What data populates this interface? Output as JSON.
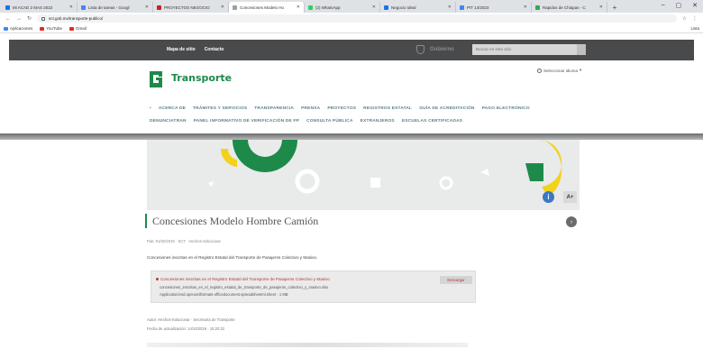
{
  "browser": {
    "tabs": [
      {
        "label": "Mi ACAD 2 MAS 2022",
        "color": "#1a73e8",
        "active": false
      },
      {
        "label": "Lista de tareas - Googl",
        "color": "#4285f4",
        "active": false
      },
      {
        "label": "PROYECTOS NEGOCIO",
        "color": "#c5221f",
        "active": false
      },
      {
        "label": "Concesiones Modelo Ho",
        "color": "#9aa0a6",
        "active": true
      },
      {
        "label": "(2) WhatsApp",
        "color": "#25d366",
        "active": false
      },
      {
        "label": "Negocio Ideal",
        "color": "#1a73e8",
        "active": false
      },
      {
        "label": "PIT 14/2023",
        "color": "#4285f4",
        "active": false
      },
      {
        "label": "Rapidos de Chiapas - C",
        "color": "#34a853",
        "active": false
      }
    ],
    "url": "sct.gob.mx/transporte-publico/",
    "bookmarks": [
      {
        "label": "Aplicaciones",
        "color": "#4285f4"
      },
      {
        "label": "YouTube",
        "color": "#d93025"
      },
      {
        "label": "Gmail",
        "color": "#d93025"
      }
    ],
    "bookmarks_right": "Lista"
  },
  "gov_bar": {
    "links": [
      "Mapa de sitio",
      "Contacto"
    ],
    "logo_text": "Gobierno",
    "search_placeholder": "Buscar en este sitio"
  },
  "header": {
    "logo_text": "Transporte",
    "language": "Seleccionar idioma"
  },
  "nav": {
    "row1": [
      "ACERCA DE",
      "TRÁMITES Y SERVICIOS",
      "TRANSPARENCIA",
      "PRENSA",
      "PROYECTOS",
      "REGISTROS ESTATAL",
      "GUÍA DE ACREDITACIÓN",
      "PAGO ELECTRÓNICO"
    ],
    "row2": [
      "DENUNCIATRAN",
      "PANEL INFORMATIVO DE VERIFICACIÓN DE FP",
      "CONSULTA PÚBLICA",
      "EXTRANJEROS",
      "ESCUELAS CERTIFICADAS"
    ]
  },
  "ui": {
    "a11y_icon": "i",
    "font_size_label": "A+",
    "next_icon": "›"
  },
  "page": {
    "title": "Concesiones Modelo Hombre Camión",
    "meta": "Pub. 01/02/2019 · SCT · Hechos-Solucionar",
    "description": "Concesiones inscritas en el Registro Estatal del Transporte de Pasajeros Colectivo y Masivo.",
    "attachment": {
      "title": "Concesiones inscritas en el Registro Estatal del Transporte de Pasajeros Colectivo y Masivo",
      "file_line": "concesiones_inscritas_en_el_registro_estatal_de_transporte_de_pasajeros_colectivo_y_masivo.xlsx",
      "path_line": "Application/vnd.openxmlformats-officedocument.spreadsheetml.sheet · 1 MB",
      "download": "Descargar"
    },
    "footer1": "Autor: Hechos-Solucionar · Secretaría de Transporte",
    "footer2": "Fecha de actualización: 14/10/2019 · 15:20:22"
  }
}
